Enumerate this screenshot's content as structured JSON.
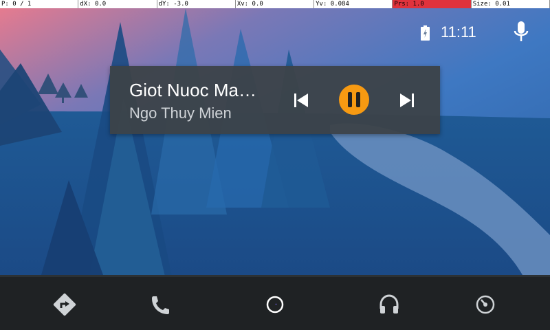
{
  "debug_bar": {
    "pointer": "P: 0 / 1",
    "dx": "dX: 0.0",
    "dy": "dY: -3.0",
    "xv": "Xv: 0.0",
    "yv": "Yv: 0.084",
    "prs": "Prs: 1.0",
    "size": "Size: 0.01",
    "alert_color": "#e0323c"
  },
  "status": {
    "time": "11:11",
    "battery_icon": "battery-charging-icon",
    "mic_icon": "microphone-icon"
  },
  "media": {
    "title": "Giot Nuoc Mat…",
    "artist": "Ngo Thuy Mien",
    "accent_color": "#f79a12",
    "state": "playing"
  },
  "nav": {
    "items": [
      {
        "name": "navigation",
        "icon": "navigation-icon"
      },
      {
        "name": "phone",
        "icon": "phone-icon"
      },
      {
        "name": "home",
        "icon": "home-circle-icon"
      },
      {
        "name": "music",
        "icon": "headphones-icon"
      },
      {
        "name": "car",
        "icon": "speedometer-icon"
      }
    ]
  }
}
